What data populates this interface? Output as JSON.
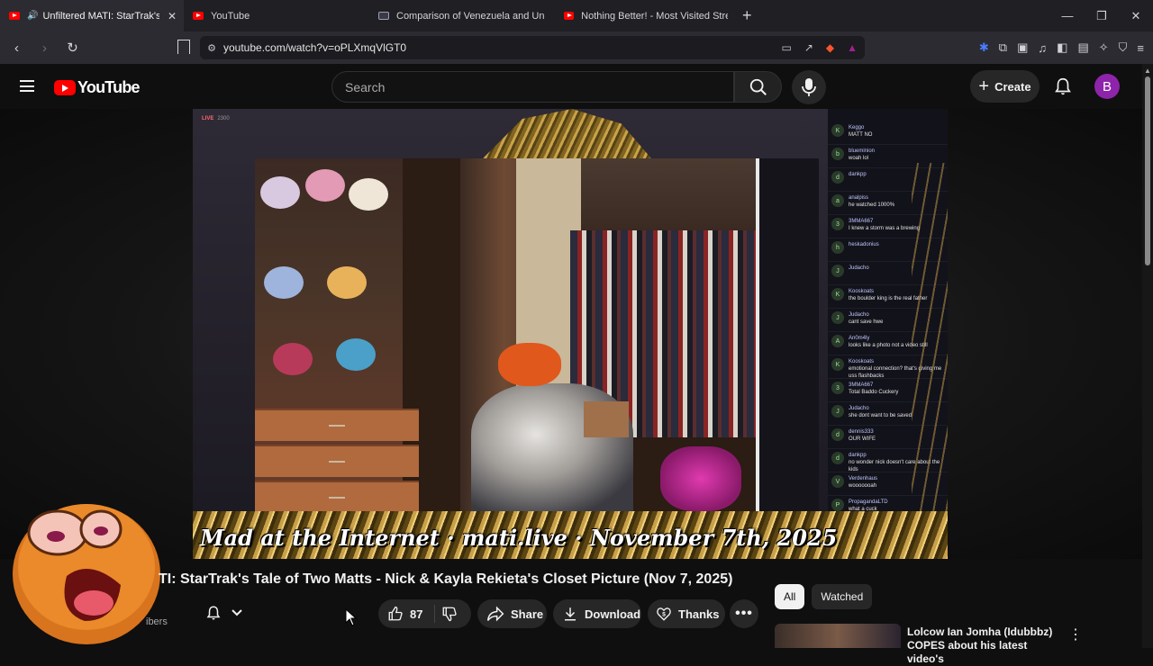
{
  "browser": {
    "tabs": [
      {
        "title": "Unfiltered MATI: StarTrak's Tal",
        "active": true,
        "audio": true,
        "icon": "youtube-icon"
      },
      {
        "title": "YouTube",
        "active": false,
        "icon": "youtube-icon"
      },
      {
        "title": "Comparison of Venezuela and United",
        "active": false,
        "icon": "document-icon"
      },
      {
        "title": "Nothing Better! - Most Visited Street",
        "active": false,
        "icon": "youtube-icon"
      }
    ],
    "new_tab_label": "+",
    "url": "youtube.com/watch?v=oPLXmqVlGT0"
  },
  "youtube": {
    "logo_text": "YouTube",
    "search_placeholder": "Search",
    "create_label": "Create",
    "avatar_letter": "B",
    "brand_color": "#ff0000"
  },
  "video": {
    "live_label": "LIVE",
    "live_count": "2300",
    "caption": "Mad at the Internet · mati.live · November 7th, 2025",
    "chat": [
      {
        "user": "Keggo",
        "msg": "MATT NO",
        "initial": "K"
      },
      {
        "user": "blueminion",
        "msg": "woah lol",
        "initial": "b"
      },
      {
        "user": "dankpp",
        "msg": "",
        "initial": "d"
      },
      {
        "user": "analpiss",
        "msg": "he watched 1000%",
        "initial": "a"
      },
      {
        "user": "3MMA667",
        "msg": "I knew a storm was a brewing",
        "initial": "3"
      },
      {
        "user": "heskadonius",
        "msg": "",
        "initial": "h"
      },
      {
        "user": "Judacho",
        "msg": "",
        "initial": "J"
      },
      {
        "user": "Kooskoats",
        "msg": "the boulder king is the real father",
        "initial": "K"
      },
      {
        "user": "Judacho",
        "msg": "cant save hwe",
        "initial": "J"
      },
      {
        "user": "An0m4ly",
        "msg": "looks like a photo not a video still",
        "initial": "A"
      },
      {
        "user": "Kooskoats",
        "msg": "emotional connection? that's giving me uss flashbacks",
        "initial": "K"
      },
      {
        "user": "3MMA667",
        "msg": "Total Baddo Cuckery",
        "initial": "3"
      },
      {
        "user": "Judacho",
        "msg": "she dont want to be saved",
        "initial": "J"
      },
      {
        "user": "dennis333",
        "msg": "OUR WIFE",
        "initial": "d"
      },
      {
        "user": "dankpp",
        "msg": "no wonder nick doesn't care about the kids",
        "initial": "d"
      },
      {
        "user": "Verdenhaus",
        "msg": "wooooooah",
        "initial": "V"
      },
      {
        "user": "PropagandaLTD",
        "msg": "what a cuck",
        "initial": "P"
      }
    ]
  },
  "watch": {
    "title": "TI: StarTrak's Tale of Two Matts - Nick & Kayla Rekieta's Closet Picture (Nov 7, 2025)",
    "subscribers_fragment": "ibers",
    "like_count": "87",
    "share_label": "Share",
    "download_label": "Download",
    "thanks_label": "Thanks",
    "chips": [
      "All",
      "Watched"
    ],
    "rec_title": "Lolcow Ian Jomha (Idubbbz) COPES about his latest video's"
  }
}
